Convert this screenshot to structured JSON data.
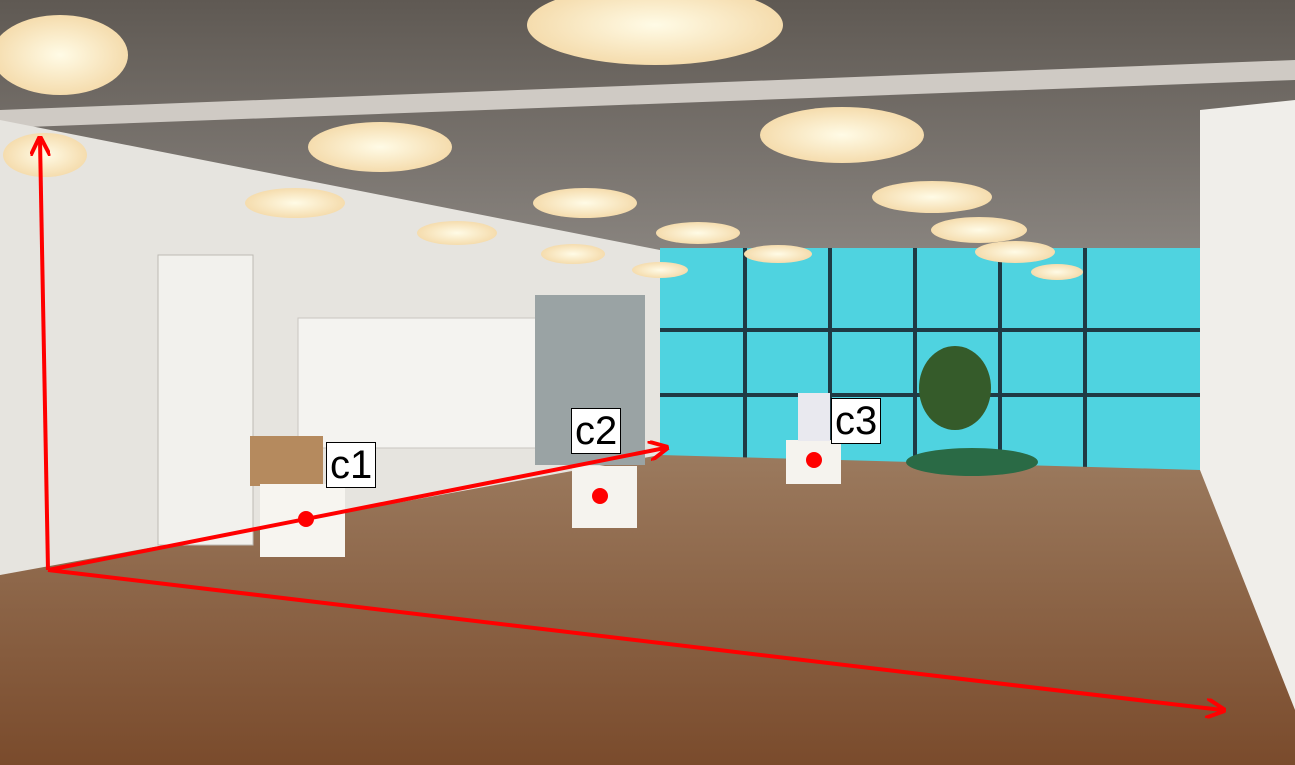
{
  "scene": {
    "kind": "indoor lobby photo with coordinate-frame annotation",
    "colors": {
      "annotation": "#ff0000",
      "floor": "#8a5a3a",
      "ceiling": "#6d6862",
      "wall": "#e8e6e2",
      "window_glass": "#4fd3e0",
      "label_bg": "#ffffff"
    }
  },
  "annotations": {
    "axes": [
      "up-axis-arrow",
      "depth-axis-arrow",
      "right-axis-arrow"
    ],
    "markers": [
      {
        "id": "c1",
        "label": "c1"
      },
      {
        "id": "c2",
        "label": "c2"
      },
      {
        "id": "c3",
        "label": "c3"
      }
    ]
  }
}
